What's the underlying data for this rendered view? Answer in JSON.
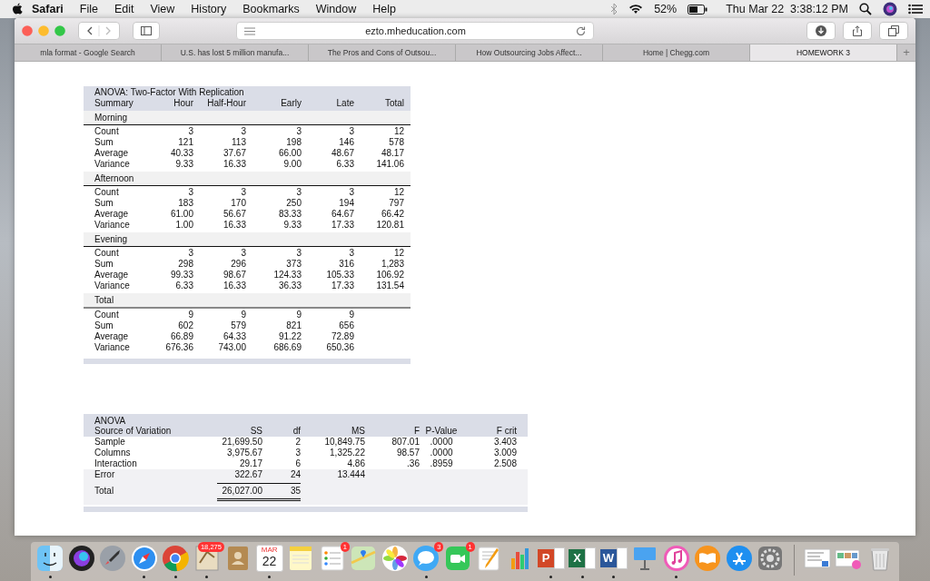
{
  "menu_bar": {
    "app": "Safari",
    "menus": [
      "File",
      "Edit",
      "View",
      "History",
      "Bookmarks",
      "Window",
      "Help"
    ],
    "battery": "52%",
    "clock": "Thu Mar 22  3:38:12 PM"
  },
  "browser": {
    "url": "ezto.mheducation.com",
    "tabs": [
      {
        "label": "mla format - Google Search",
        "selected": false
      },
      {
        "label": "U.S. has lost 5 million manufa...",
        "selected": false
      },
      {
        "label": "The Pros and Cons of Outsou...",
        "selected": false
      },
      {
        "label": "How Outsourcing Jobs Affect...",
        "selected": false
      },
      {
        "label": "Home | Chegg.com",
        "selected": false
      },
      {
        "label": "HOMEWORK 3",
        "selected": true
      }
    ],
    "new_tab": "+"
  },
  "summary_table": {
    "title": "ANOVA: Two-Factor With Replication",
    "columns": [
      "Summary",
      "Hour",
      "Half-Hour",
      "Early",
      "Late",
      "Total"
    ],
    "groups": [
      {
        "label": "Morning",
        "rows": [
          [
            "Count",
            "3",
            "3",
            "3",
            "3",
            "12"
          ],
          [
            "Sum",
            "121",
            "113",
            "198",
            "146",
            "578"
          ],
          [
            "Average",
            "40.33",
            "37.67",
            "66.00",
            "48.67",
            "48.17"
          ],
          [
            "Variance",
            "9.33",
            "16.33",
            "9.00",
            "6.33",
            "141.06"
          ]
        ]
      },
      {
        "label": "Afternoon",
        "rows": [
          [
            "Count",
            "3",
            "3",
            "3",
            "3",
            "12"
          ],
          [
            "Sum",
            "183",
            "170",
            "250",
            "194",
            "797"
          ],
          [
            "Average",
            "61.00",
            "56.67",
            "83.33",
            "64.67",
            "66.42"
          ],
          [
            "Variance",
            "1.00",
            "16.33",
            "9.33",
            "17.33",
            "120.81"
          ]
        ]
      },
      {
        "label": "Evening",
        "rows": [
          [
            "Count",
            "3",
            "3",
            "3",
            "3",
            "12"
          ],
          [
            "Sum",
            "298",
            "296",
            "373",
            "316",
            "1,283"
          ],
          [
            "Average",
            "99.33",
            "98.67",
            "124.33",
            "105.33",
            "106.92"
          ],
          [
            "Variance",
            "6.33",
            "16.33",
            "36.33",
            "17.33",
            "131.54"
          ]
        ]
      },
      {
        "label": "Total",
        "rows": [
          [
            "Count",
            "9",
            "9",
            "9",
            "9"
          ],
          [
            "Sum",
            "602",
            "579",
            "821",
            "656"
          ],
          [
            "Average",
            "66.89",
            "64.33",
            "91.22",
            "72.89"
          ],
          [
            "Variance",
            "676.36",
            "743.00",
            "686.69",
            "650.36"
          ]
        ]
      }
    ]
  },
  "anova_table": {
    "title": "ANOVA",
    "columns": [
      "Source of Variation",
      "SS",
      "df",
      "MS",
      "F",
      "P-Value",
      "F crit"
    ],
    "rows": [
      {
        "kind": "data",
        "cells": [
          "Sample",
          "21,699.50",
          "2",
          "10,849.75",
          "807.01",
          ".0000",
          "3.403"
        ]
      },
      {
        "kind": "data",
        "cells": [
          "Columns",
          "3,975.67",
          "3",
          "1,325.22",
          "98.57",
          ".0000",
          "3.009"
        ]
      },
      {
        "kind": "data",
        "cells": [
          "Interaction",
          "29.17",
          "6",
          "4.86",
          ".36",
          ".8959",
          "2.508"
        ]
      },
      {
        "kind": "data",
        "cells": [
          "Error",
          "322.67",
          "24",
          "13.444"
        ]
      },
      {
        "kind": "total",
        "cells": [
          "Total",
          "26,027.00",
          "35"
        ]
      }
    ]
  },
  "dock": {
    "items": [
      {
        "kind": "finder",
        "running": true
      },
      {
        "kind": "siri",
        "running": false
      },
      {
        "kind": "launchpad",
        "running": false
      },
      {
        "kind": "safari",
        "running": true
      },
      {
        "kind": "chrome",
        "running": true
      },
      {
        "kind": "mail",
        "running": true,
        "badge": "18,275"
      },
      {
        "kind": "contacts",
        "running": false
      },
      {
        "kind": "calendar",
        "running": true,
        "month": "MAR",
        "day": "22"
      },
      {
        "kind": "notes",
        "running": false
      },
      {
        "kind": "reminders",
        "running": false,
        "badge": "1"
      },
      {
        "kind": "maps",
        "running": false
      },
      {
        "kind": "photos",
        "running": false
      },
      {
        "kind": "messages",
        "running": true,
        "badge": "3"
      },
      {
        "kind": "facetime",
        "running": false,
        "badge": "1"
      },
      {
        "kind": "pages",
        "running": false
      },
      {
        "kind": "numbers",
        "running": false
      },
      {
        "kind": "office",
        "running": true,
        "letter": "P"
      },
      {
        "kind": "office",
        "running": true,
        "letter": "X"
      },
      {
        "kind": "office",
        "running": true,
        "letter": "W"
      },
      {
        "kind": "keynote",
        "running": false
      },
      {
        "kind": "itunes",
        "running": true
      },
      {
        "kind": "ibooks",
        "running": false
      },
      {
        "kind": "appstore",
        "running": false
      },
      {
        "kind": "preferences",
        "running": false
      },
      {
        "kind": "separator"
      },
      {
        "kind": "document",
        "running": false
      },
      {
        "kind": "images",
        "running": false
      },
      {
        "kind": "trash",
        "running": false
      }
    ]
  }
}
